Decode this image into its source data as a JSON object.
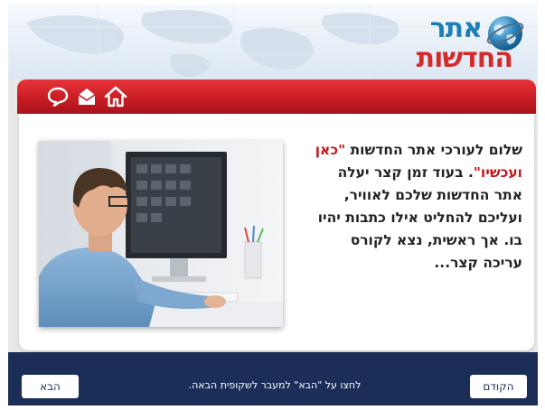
{
  "logo": {
    "line1": "אתר",
    "line2": "החדשות",
    "icon": "globe-icon"
  },
  "nav": {
    "icons": [
      "chat-bubble-icon",
      "envelope-icon",
      "home-icon"
    ]
  },
  "content": {
    "before": "שלום לעורכי אתר החדשות ",
    "highlight": "\"כאן ועכשיו\"",
    "after": ". בעוד זמן קצר יעלה אתר החדשות שלכם  לאוויר, ועליכם להחליט אילו כתבות יהיו בו. אך ראשית, נצא לקורס עריכה קצר...",
    "image": "man-at-computer-photo"
  },
  "footer": {
    "hint": "לחצו על \"הבא\" למעבר לשקופית הבאה.",
    "next_label": "הבא",
    "prev_label": "הקודם"
  },
  "colors": {
    "red_bar": "#c81d24",
    "footer": "#1a2e57",
    "highlight": "#c4161c",
    "logo_blue": "#1e7fb7",
    "logo_red": "#d42a2a"
  }
}
